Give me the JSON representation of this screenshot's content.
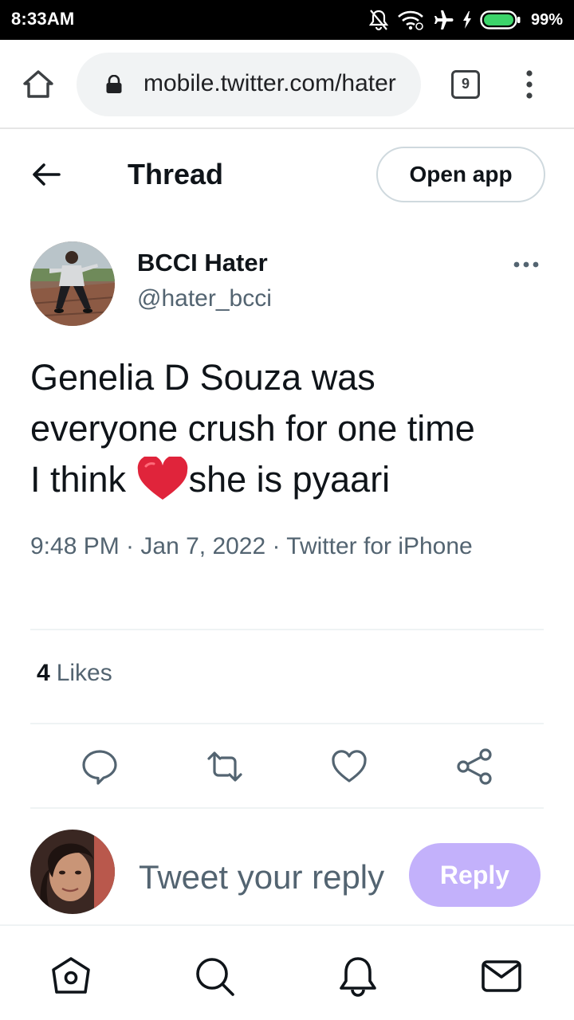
{
  "status_bar": {
    "time": "8:33AM",
    "battery": "99%",
    "icons": [
      "bell-off-icon",
      "wifi-icon",
      "airplane-icon",
      "charging-icon",
      "battery-icon"
    ]
  },
  "browser": {
    "url": "mobile.twitter.com/hater",
    "tab_count": "9",
    "icons": [
      "home-icon",
      "lock-icon",
      "more-vertical-icon"
    ]
  },
  "header": {
    "title": "Thread",
    "open_app_label": "Open app"
  },
  "tweet": {
    "author_name": "BCCI Hater",
    "author_handle": "@hater_bcci",
    "text_line1": "Genelia D Souza was",
    "text_line2": "everyone crush for one time",
    "text_line3_pre": "I think ",
    "text_line3_post": "she is pyaari",
    "emoji": "red-heart",
    "meta": "9:48 PM · Jan 7, 2022 · Twitter for iPhone",
    "likes_count": "4",
    "likes_label": "Likes"
  },
  "actions": [
    "reply-icon",
    "retweet-icon",
    "like-icon",
    "share-icon"
  ],
  "composer": {
    "placeholder": "Tweet your reply",
    "reply_label": "Reply"
  },
  "bottom_nav": [
    "home-icon",
    "search-icon",
    "notifications-icon",
    "messages-icon"
  ],
  "colors": {
    "primary_text": "#0f1419",
    "secondary_text": "#536471",
    "reply_button": "#c3b1fb",
    "emoji_red": "#e0243b"
  }
}
